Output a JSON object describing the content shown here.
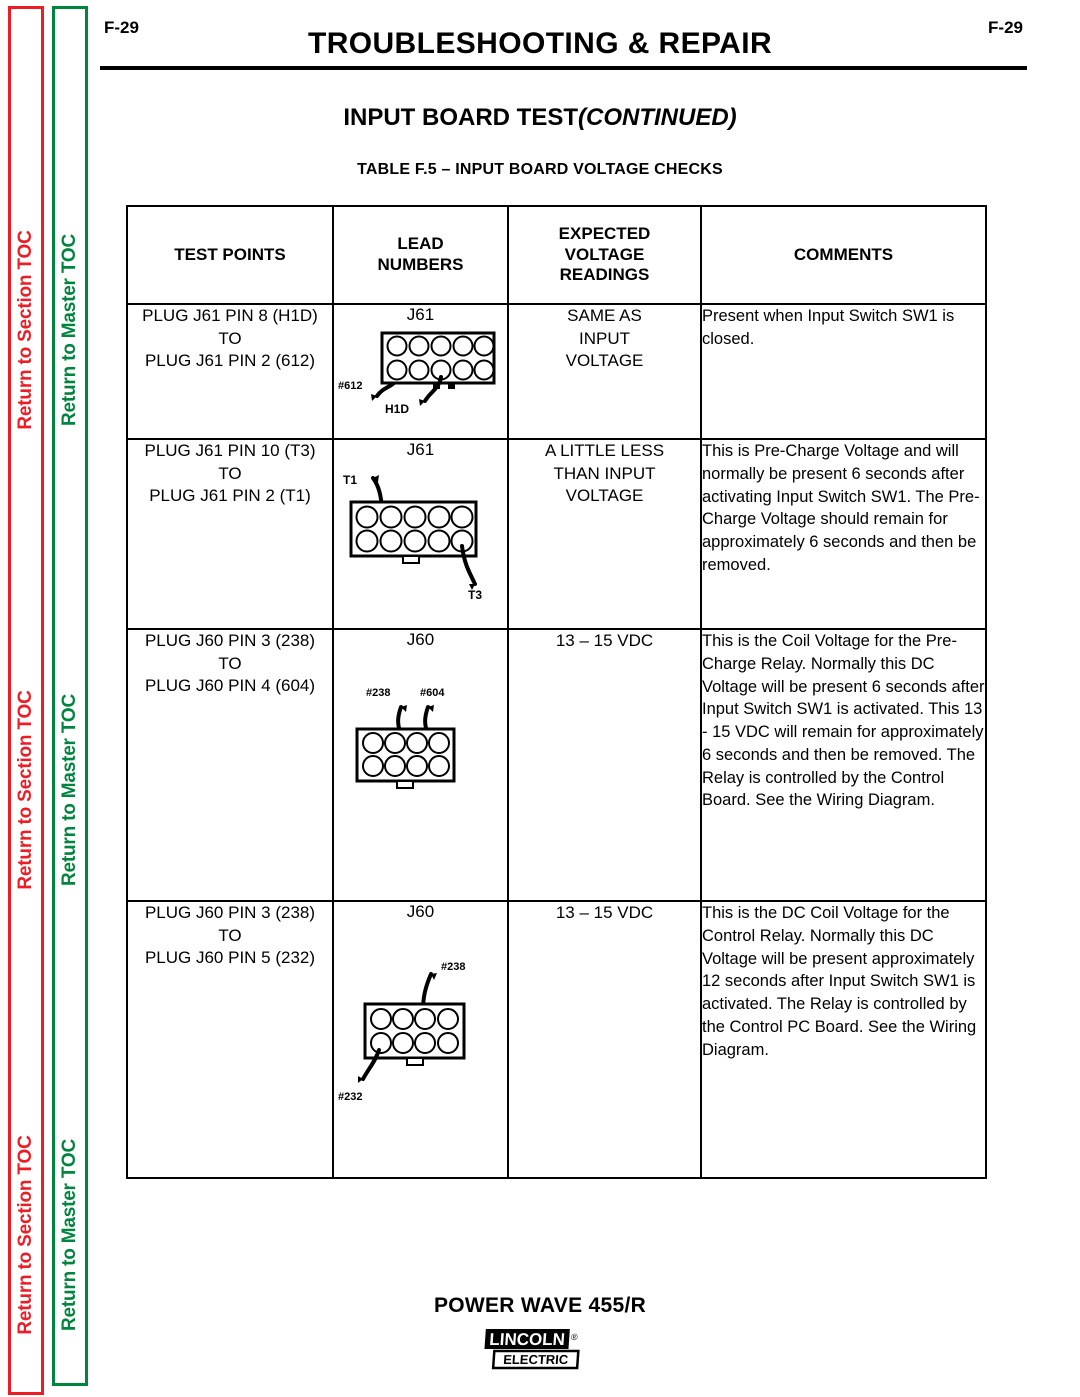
{
  "nav": {
    "section_toc_label": "Return to Section TOC",
    "master_toc_label": "Return to Master TOC",
    "section_color": "#EE1C25",
    "master_color": "#00853F"
  },
  "header": {
    "page_number_left": "F-29",
    "page_number_right": "F-29",
    "doc_title": "TROUBLESHOOTING & REPAIR",
    "section_title_main": "INPUT BOARD TEST",
    "section_title_continued": "(CONTINUED)",
    "table_caption": "TABLE F.5 – INPUT BOARD VOLTAGE CHECKS"
  },
  "table": {
    "columns": [
      "TEST POINTS",
      "LEAD\nNUMBERS",
      "EXPECTED\nVOLTAGE\nREADINGS",
      "COMMENTS"
    ],
    "column_headers": {
      "test_points": "TEST POINTS",
      "lead_numbers_line1": "LEAD",
      "lead_numbers_line2": "NUMBERS",
      "expected_line1": "EXPECTED",
      "expected_line2": "VOLTAGE",
      "expected_line3": "READINGS",
      "comments": "COMMENTS"
    },
    "rows": [
      {
        "test_points_line1": "PLUG J61  PIN 8 (H1D)",
        "test_points_line2": "TO",
        "test_points_line3": "PLUG J61 PIN 2 (612)",
        "lead_number": "J61",
        "connector": {
          "type": "J61",
          "columns": 5,
          "rows": 2,
          "callouts": [
            {
              "label": "#612",
              "pin_col": 1,
              "pin_row": 2,
              "side": "left"
            },
            {
              "label": "H1D",
              "pin_col": 3,
              "pin_row": 2,
              "side": "bottom"
            }
          ]
        },
        "expected_line1": "SAME AS",
        "expected_line2": "INPUT",
        "expected_line3": "VOLTAGE",
        "comments": "Present when Input Switch SW1 is closed."
      },
      {
        "test_points_line1": "PLUG J61  PIN 10 (T3)",
        "test_points_line2": "TO",
        "test_points_line3": "PLUG J61 PIN 2 (T1)",
        "lead_number": "J61",
        "connector": {
          "type": "J61",
          "columns": 5,
          "rows": 2,
          "callouts": [
            {
              "label": "T1",
              "pin_col": 2,
              "pin_row": 1,
              "side": "top"
            },
            {
              "label": "T3",
              "pin_col": 5,
              "pin_row": 2,
              "side": "bottom-right"
            }
          ]
        },
        "expected_line1": "A LITTLE LESS",
        "expected_line2": "THAN INPUT",
        "expected_line3": "VOLTAGE",
        "comments": "This is Pre-Charge Voltage and will normally be present 6 seconds after activating Input Switch SW1.  The Pre-Charge Voltage should remain for approximately 6 seconds and then be removed."
      },
      {
        "test_points_line1": "PLUG J60  PIN 3 (238)",
        "test_points_line2": "TO",
        "test_points_line3": "PLUG J60 PIN 4 (604)",
        "lead_number": "J60",
        "connector": {
          "type": "J60",
          "columns": 4,
          "rows": 2,
          "callouts": [
            {
              "label": "#238",
              "pin_col": 3,
              "pin_row": 1,
              "side": "top"
            },
            {
              "label": "#604",
              "pin_col": 4,
              "pin_row": 1,
              "side": "top"
            }
          ]
        },
        "expected_line1": "13 – 15 VDC",
        "expected_line2": "",
        "expected_line3": "",
        "comments": "This is the Coil Voltage for the Pre-Charge Relay.  Normally this DC Voltage will be present 6 seconds after Input Switch SW1 is activated. This 13 - 15 VDC will remain for approximately 6 seconds and then be removed.  The Relay is controlled by the Control Board.   See the Wiring Diagram."
      },
      {
        "test_points_line1": "PLUG J60  PIN 3 (238)",
        "test_points_line2": "TO",
        "test_points_line3": "PLUG J60 PIN 5 (232)",
        "lead_number": "J60",
        "connector": {
          "type": "J60",
          "columns": 4,
          "rows": 2,
          "callouts": [
            {
              "label": "#238",
              "pin_col": 3,
              "pin_row": 1,
              "side": "top-right"
            },
            {
              "label": "#232",
              "pin_col": 1,
              "pin_row": 2,
              "side": "bottom-left"
            }
          ]
        },
        "expected_line1": "13 – 15 VDC",
        "expected_line2": "",
        "expected_line3": "",
        "comments": "This is the DC Coil Voltage for the Control Relay.   Normally this DC Voltage will be present approximately 12 seconds after Input Switch SW1 is activated.  The Relay is controlled by the Control PC Board.  See the Wiring Diagram."
      }
    ]
  },
  "footer": {
    "product_name": "POWER WAVE 455/R",
    "brand_primary": "LINCOLN",
    "brand_secondary": "ELECTRIC",
    "brand_registered": "®"
  }
}
